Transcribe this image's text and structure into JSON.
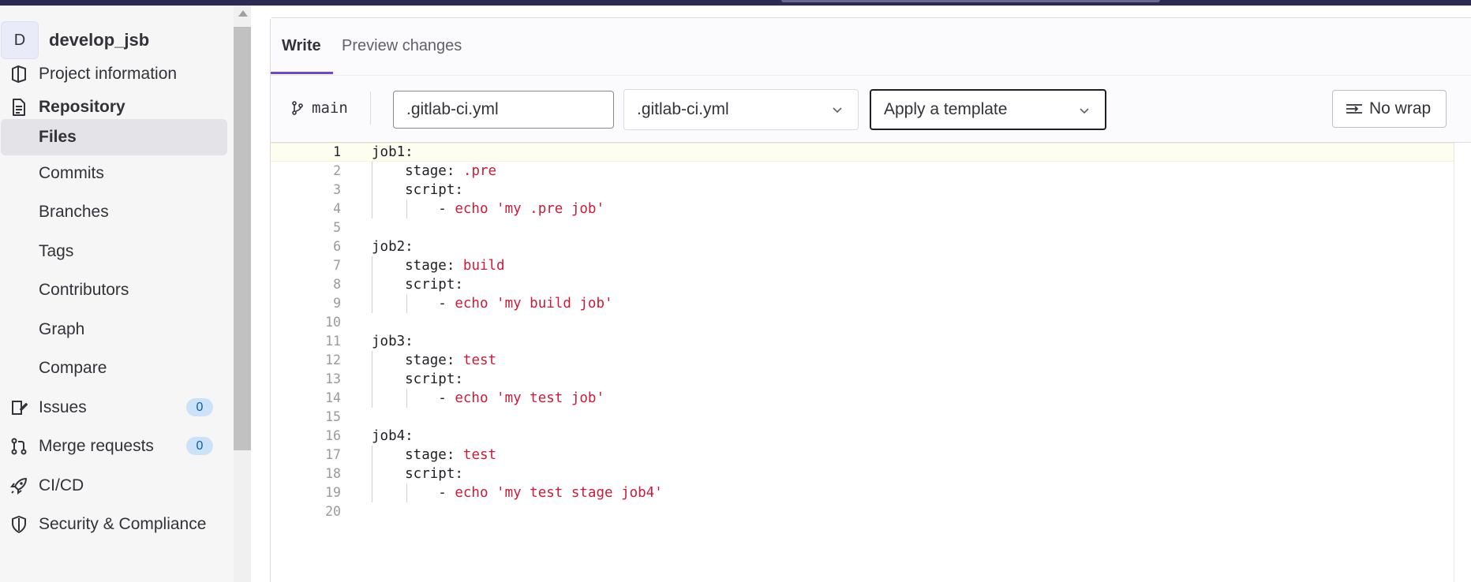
{
  "sidebar": {
    "project_initial": "D",
    "project_name": "develop_jsb",
    "items": [
      {
        "label": "Project information",
        "icon": "project-info-icon"
      },
      {
        "label": "Repository",
        "icon": "repository-icon"
      },
      {
        "label": "Files"
      },
      {
        "label": "Commits"
      },
      {
        "label": "Branches"
      },
      {
        "label": "Tags"
      },
      {
        "label": "Contributors"
      },
      {
        "label": "Graph"
      },
      {
        "label": "Compare"
      },
      {
        "label": "Issues",
        "icon": "issues-icon",
        "badge": "0"
      },
      {
        "label": "Merge requests",
        "icon": "merge-request-icon",
        "badge": "0"
      },
      {
        "label": "CI/CD",
        "icon": "rocket-icon"
      },
      {
        "label": "Security & Compliance",
        "icon": "shield-icon"
      }
    ]
  },
  "editor": {
    "tabs": [
      {
        "label": "Write"
      },
      {
        "label": "Preview changes"
      }
    ],
    "branch": "main",
    "file_name": ".gitlab-ci.yml",
    "file_type": ".gitlab-ci.yml",
    "template_placeholder": "Apply a template",
    "wrap_label": "No wrap",
    "lines": [
      {
        "n": "1",
        "key": "job1:",
        "val": ""
      },
      {
        "n": "2",
        "key": "    stage: ",
        "val": ".pre"
      },
      {
        "n": "3",
        "key": "    script:",
        "val": ""
      },
      {
        "n": "4",
        "key": "        - ",
        "val": "echo 'my .pre job'"
      },
      {
        "n": "5",
        "key": "",
        "val": ""
      },
      {
        "n": "6",
        "key": "job2:",
        "val": ""
      },
      {
        "n": "7",
        "key": "    stage: ",
        "val": "build"
      },
      {
        "n": "8",
        "key": "    script:",
        "val": ""
      },
      {
        "n": "9",
        "key": "        - ",
        "val": "echo 'my build job'"
      },
      {
        "n": "10",
        "key": "",
        "val": ""
      },
      {
        "n": "11",
        "key": "job3:",
        "val": ""
      },
      {
        "n": "12",
        "key": "    stage: ",
        "val": "test"
      },
      {
        "n": "13",
        "key": "    script:",
        "val": ""
      },
      {
        "n": "14",
        "key": "        - ",
        "val": "echo 'my test job'"
      },
      {
        "n": "15",
        "key": "",
        "val": ""
      },
      {
        "n": "16",
        "key": "job4:",
        "val": ""
      },
      {
        "n": "17",
        "key": "    stage: ",
        "val": "test"
      },
      {
        "n": "18",
        "key": "    script:",
        "val": ""
      },
      {
        "n": "19",
        "key": "        - ",
        "val": "echo 'my test stage job4'"
      },
      {
        "n": "20",
        "key": "",
        "val": ""
      }
    ]
  },
  "colors": {
    "accent": "#6e49cb",
    "string_value": "#c91c3a",
    "badge_bg": "#cbe2f9",
    "topbar": "#2b2a55"
  }
}
